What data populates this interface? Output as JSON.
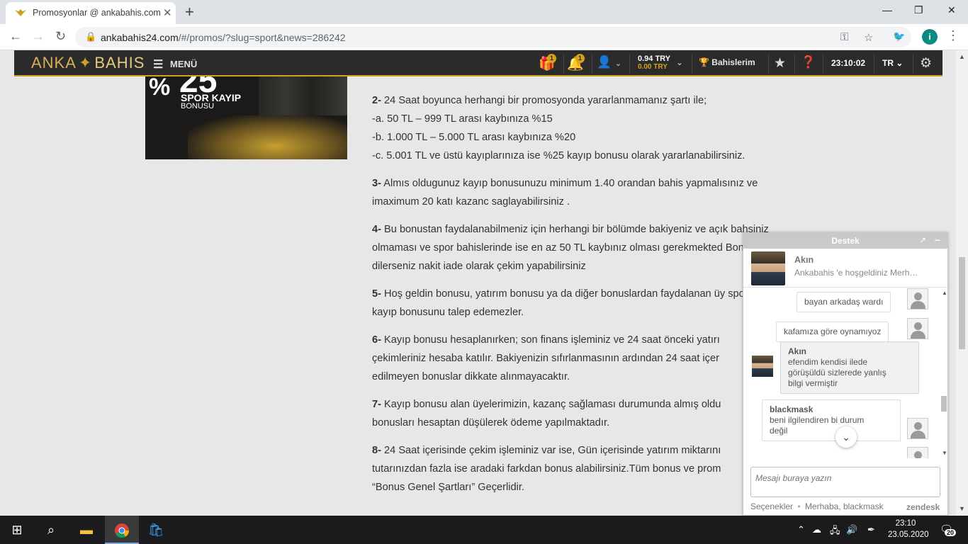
{
  "browser": {
    "tab_title": "Promosyonlar @ ankabahis.com",
    "url_host": "ankabahis24.com",
    "url_path": "/#/promos/?slug=sport&news=286242",
    "profile_initial": "i"
  },
  "site_nav": {
    "logo_left": "ANKA",
    "logo_right": "BAHIS",
    "menu_label": "MENÜ",
    "gift_badge": "1",
    "bell_badge": "1",
    "balance_main": "0.94 TRY",
    "balance_bonus": "0.00 TRY",
    "bets_label": "Bahislerim",
    "time": "23:10:02",
    "language": "TR"
  },
  "banner": {
    "percent": "%",
    "number": "25",
    "line1": "SPOR KAYIP",
    "line2": "BONUSU"
  },
  "article": {
    "paragraphs": [
      {
        "num": "2-",
        "text": " 24 Saat boyunca herhangi bir promosyonda yararlanmamanız şartı ile;"
      },
      {
        "num": "",
        "text": "-a. 50 TL – 999 TL arası kaybınıza %15"
      },
      {
        "num": "",
        "text": "-b. 1.000 TL – 5.000 TL arası kaybınıza %20"
      },
      {
        "num": "",
        "text": "-c. 5.001 TL ve üstü kayıplarınıza ise %25 kayıp bonusu olarak yararlanabilirsiniz."
      },
      {
        "num": "3-",
        "text": " Almıs oldugunuz kayıp bonusunuzu minimum 1.40 orandan bahis yapmalısınız ve imaximum 20 katı kazanc saglayabilirsiniz ."
      },
      {
        "num": "4-",
        "text": " Bu bonustan faydalanabilmeniz için herhangi bir bölümde bakiyeniz ve açık bahsiniz olmaması ve spor bahislerinde ise en az 50 TL kaybınız olması gerekmekted Bonusunu dilerseniz nakit iade olarak çekim yapabilirsiniz"
      },
      {
        "num": "5-",
        "text": " Hoş geldin bonusu, yatırım bonusu ya da diğer bonuslardan faydalanan üy spor kayıp bonusunu talep edemezler."
      },
      {
        "num": "6-",
        "text": " Kayıp bonusu hesaplanırken; son finans işleminiz ve 24 saat önceki yatırı çekimleriniz hesaba katılır. Bakiyenizin sıfırlanmasının ardından 24 saat içer edilmeyen bonuslar dikkate alınmayacaktır."
      },
      {
        "num": "7-",
        "text": " Kayıp bonusu alan üyelerimizin, kazanç sağlaması durumunda almış oldu bonusları hesaptan düşülerek ödeme yapılmaktadır."
      },
      {
        "num": "8-",
        "text": " 24 Saat içerisinde çekim işleminiz var ise, Gün içerisinde yatırım miktarını tutarınızdan fazla ise aradaki farkdan bonus alabilirsiniz.Tüm bonus ve prom “Bonus Genel Şartları” Geçerlidir."
      }
    ]
  },
  "chat": {
    "header_title": "Destek",
    "agent_name": "Akın",
    "agent_greeting": "Ankabahis 'e hoşgeldiniz Merh…",
    "messages": {
      "m1": "bayan arkadaş wardı",
      "m2": "kafamıza göre oynamıyoz",
      "m3_who": "Akın",
      "m3_l1": "efendim kendisi ilede",
      "m3_l2": "görüşüldü sizlerede yanlış",
      "m3_l3": "bilgi vermiştir",
      "m4_who": "blackmask",
      "m4_l1": "beni ilgilendiren bi durum",
      "m4_l2": "değil"
    },
    "input_placeholder": "Mesajı buraya yazın",
    "footer_options": "Seçenekler",
    "footer_sep": "•",
    "footer_greeting": "Merhaba, blackmask",
    "footer_brand": "zendesk"
  },
  "taskbar": {
    "time": "23:10",
    "date": "23.05.2020",
    "notif_count": "20"
  }
}
